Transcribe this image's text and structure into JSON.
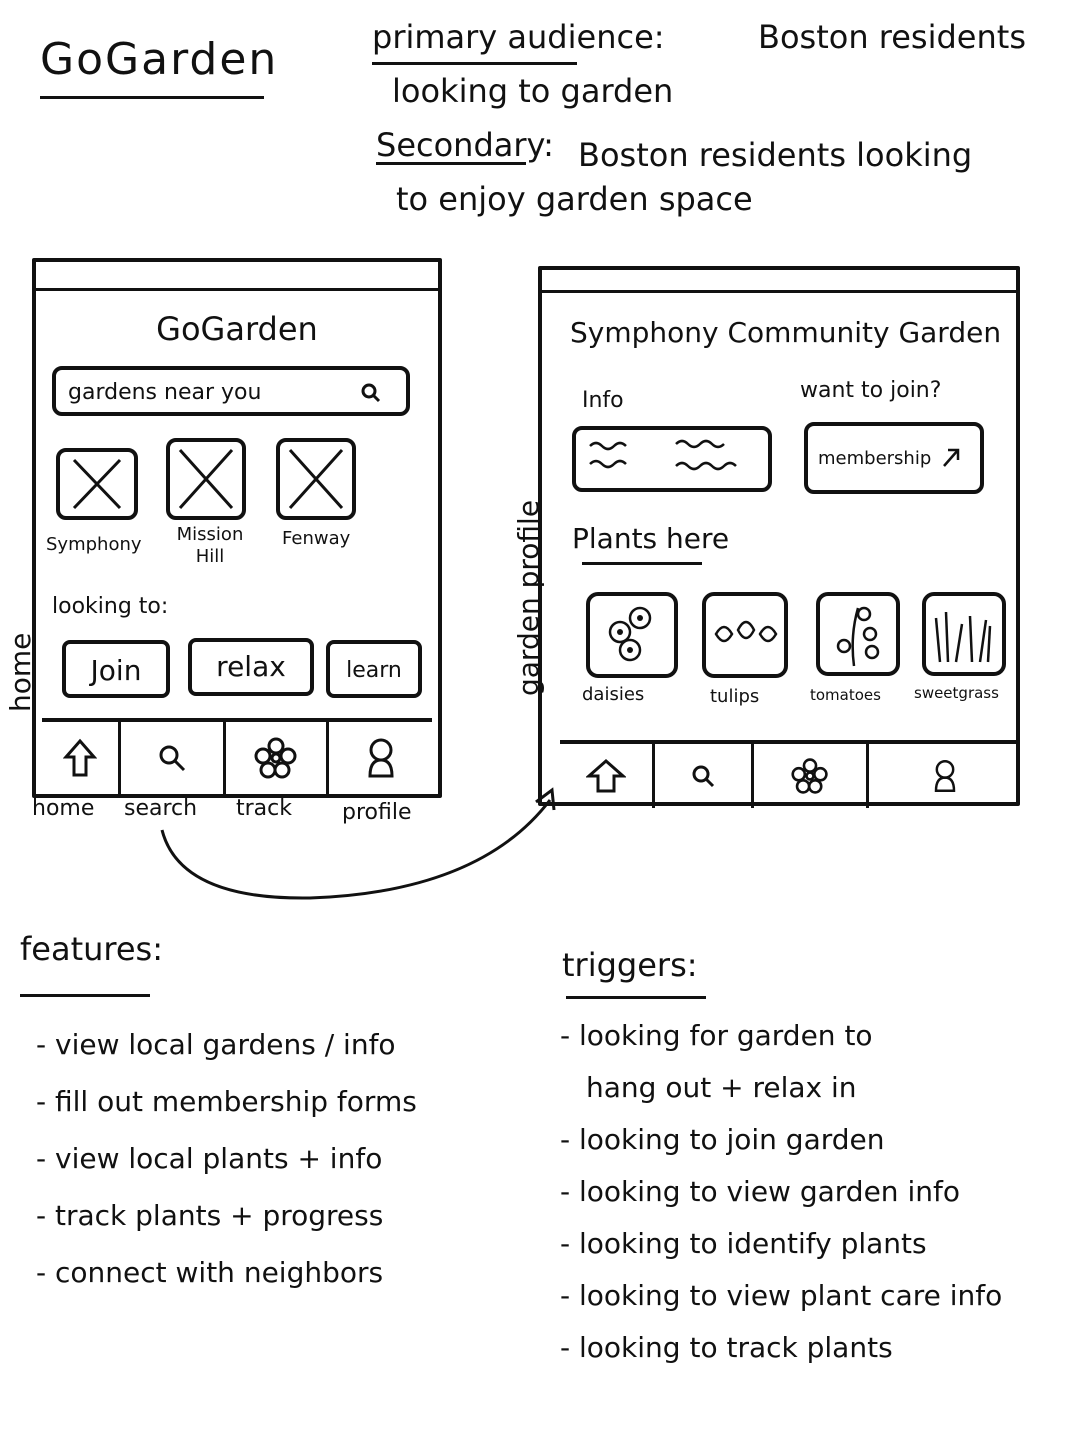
{
  "app_title": "GoGarden",
  "audience": {
    "primary_label": "primary audience:",
    "primary_text_1": "Boston residents",
    "primary_text_2": "looking to garden",
    "secondary_label": "Secondary:",
    "secondary_text_1": "Boston residents looking",
    "secondary_text_2": "to enjoy garden space"
  },
  "home_screen": {
    "side_label": "home",
    "title": "GoGarden",
    "search_placeholder": "gardens near you",
    "gardens": [
      {
        "label_1": "Symphony",
        "label_2": ""
      },
      {
        "label_1": "Mission",
        "label_2": "Hill"
      },
      {
        "label_1": "Fenway",
        "label_2": ""
      }
    ],
    "looking_to_label": "looking to:",
    "buttons": [
      "Join",
      "relax",
      "learn"
    ],
    "nav": [
      "home",
      "search",
      "track",
      "profile"
    ]
  },
  "profile_screen": {
    "side_label": "garden profile",
    "title": "Symphony Community Garden",
    "info_label": "Info",
    "join_label": "want to join?",
    "membership_label": "membership",
    "plants_label": "Plants here",
    "plants": [
      "daisies",
      "tulips",
      "tomatoes",
      "sweetgrass"
    ]
  },
  "features": {
    "heading": "features:",
    "items": [
      "- view local gardens / info",
      "- fill out membership forms",
      "- view local plants + info",
      "- track plants + progress",
      "- connect with neighbors"
    ]
  },
  "triggers": {
    "heading": "triggers:",
    "items": [
      "- looking for garden to",
      "hang out + relax in",
      "- looking to join garden",
      "- looking to view garden info",
      "- looking to identify plants",
      "- looking to view plant care info",
      "- looking to track plants"
    ]
  }
}
